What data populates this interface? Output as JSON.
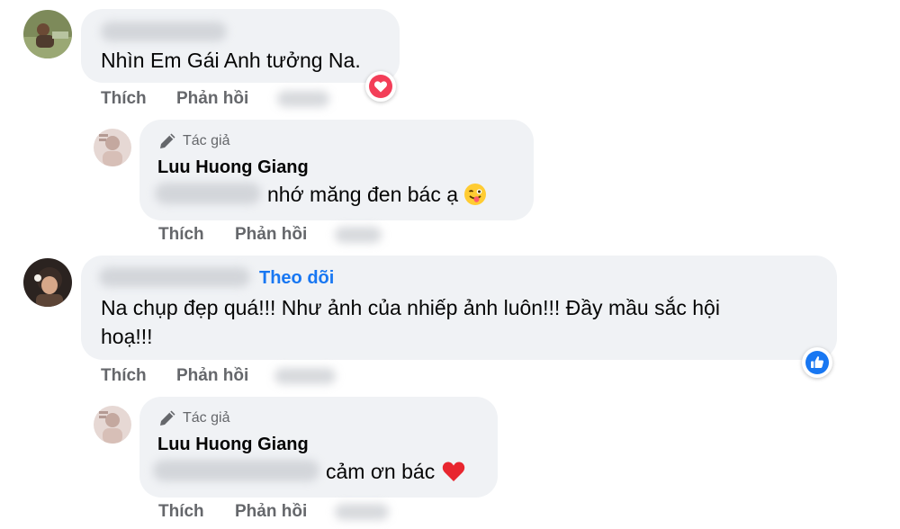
{
  "comments": [
    {
      "text": "Nhìn Em Gái Anh tưởng Na.",
      "actions": {
        "like": "Thích",
        "reply": "Phản hồi"
      },
      "reaction": "heart-reaction-icon",
      "reply": {
        "badge": "Tác giả",
        "author": "Luu Huong Giang",
        "text": "nhớ măng đen bác ạ",
        "emoji": "winking-tongue-emoji-icon",
        "actions": {
          "like": "Thích",
          "reply": "Phản hồi"
        }
      }
    },
    {
      "follow_label": "Theo dõi",
      "text_line1": "Na chụp đẹp quá!!! Như ảnh của nhiếp ảnh luôn!!! Đầy mầu sắc hội",
      "text_line2": "hoạ!!!",
      "actions": {
        "like": "Thích",
        "reply": "Phản hồi"
      },
      "reaction": "like-reaction-icon",
      "reply": {
        "badge": "Tác giả",
        "author": "Luu Huong Giang",
        "text": "cảm ơn bác",
        "emoji": "red-heart-emoji-icon",
        "actions": {
          "like": "Thích",
          "reply": "Phản hồi"
        }
      }
    }
  ],
  "colors": {
    "bubble": "#f0f2f5",
    "action_text": "#65676b",
    "follow": "#1877f2",
    "heart": "#f33e58",
    "like": "#1877f2"
  }
}
